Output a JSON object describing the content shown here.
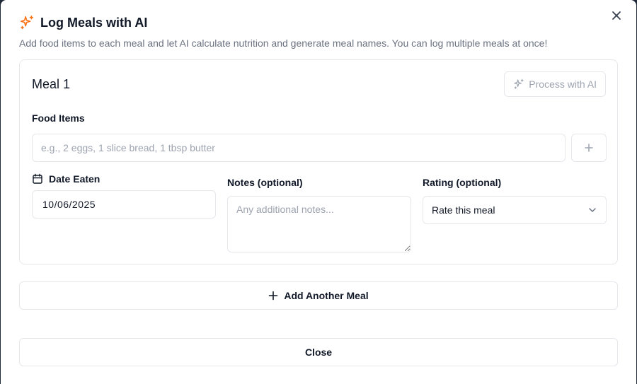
{
  "dialog": {
    "title": "Log Meals with AI",
    "subtitle": "Add food items to each meal and let AI calculate nutrition and generate meal names. You can log multiple meals at once!",
    "title_icon": "sparkles-icon",
    "accent_color": "#f97316"
  },
  "meal": {
    "title": "Meal 1",
    "process_label": "Process with AI",
    "food_items_label": "Food Items",
    "food_placeholder": "e.g., 2 eggs, 1 slice bread, 1 tbsp butter",
    "food_value": "",
    "date_label": "Date Eaten",
    "date_value": "10/06/2025",
    "notes_label": "Notes (optional)",
    "notes_placeholder": "Any additional notes...",
    "rating_label": "Rating (optional)",
    "rating_value": "Rate this meal"
  },
  "actions": {
    "add_meal_label": "Add Another Meal",
    "close_label": "Close"
  }
}
